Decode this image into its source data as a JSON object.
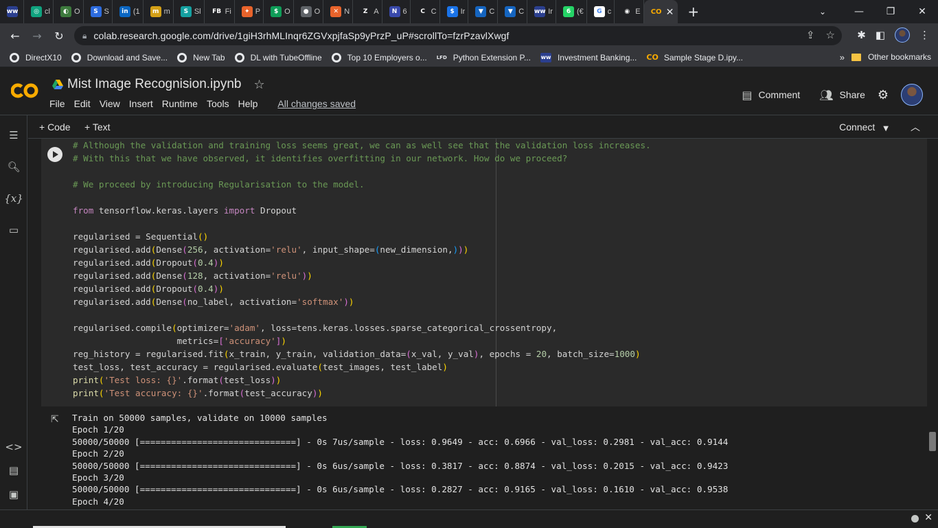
{
  "browser": {
    "tabs": [
      {
        "icon": "ww-icon",
        "label": "",
        "color": "#2b3f8f",
        "glyph": "ww"
      },
      {
        "icon": "openai-icon",
        "label": "cl",
        "color": "#10a37f",
        "glyph": "◎"
      },
      {
        "icon": "o-icon",
        "label": "O",
        "color": "#3d7a3d",
        "glyph": "◐"
      },
      {
        "icon": "s-icon",
        "label": "S",
        "color": "#2d6cdf",
        "glyph": "S"
      },
      {
        "icon": "linkedin-icon",
        "label": "(1",
        "color": "#0a66c2",
        "glyph": "in"
      },
      {
        "icon": "m-icon",
        "label": "m",
        "color": "#d4a017",
        "glyph": "m"
      },
      {
        "icon": "sl-icon",
        "label": "Sl",
        "color": "#15a1a1",
        "glyph": "S"
      },
      {
        "icon": "fb-icon",
        "label": "Fi",
        "color": "#202124",
        "glyph": "FB"
      },
      {
        "icon": "p-icon",
        "label": "P",
        "color": "#e8632b",
        "glyph": "✦"
      },
      {
        "icon": "dollar-icon",
        "label": "O",
        "color": "#0f9d58",
        "glyph": "$"
      },
      {
        "icon": "circle-icon",
        "label": "O",
        "color": "#5f6368",
        "glyph": "●"
      },
      {
        "icon": "n-icon",
        "label": "N",
        "color": "#e8632b",
        "glyph": "✕"
      },
      {
        "icon": "a-icon",
        "label": "A",
        "color": "#202124",
        "glyph": "Z"
      },
      {
        "icon": "n6-icon",
        "label": "6",
        "color": "#3949ab",
        "glyph": "N"
      },
      {
        "icon": "c-icon",
        "label": "C",
        "color": "#202124",
        "glyph": "C"
      },
      {
        "icon": "ir-icon",
        "label": "Ir",
        "color": "#1a73e8",
        "glyph": "$"
      },
      {
        "icon": "shield-icon",
        "label": "C",
        "color": "#1565c0",
        "glyph": "▼"
      },
      {
        "icon": "shield-icon-2",
        "label": "C",
        "color": "#1565c0",
        "glyph": "▼"
      },
      {
        "icon": "ww-icon-2",
        "label": "Ir",
        "color": "#2b3f8f",
        "glyph": "ww"
      },
      {
        "icon": "whatsapp-icon",
        "label": "(€",
        "color": "#25d366",
        "glyph": "6"
      },
      {
        "icon": "google-icon",
        "label": "c",
        "color": "#ffffff",
        "glyph": "G"
      },
      {
        "icon": "github-icon",
        "label": "E",
        "color": "#202124",
        "glyph": "◉"
      }
    ],
    "active_tab_icon": "CO",
    "active_tab_close": "✕",
    "new_tab": "+",
    "window_controls": {
      "dropdown": "⌄",
      "minimize": "—",
      "restore": "❐",
      "close": "✕"
    },
    "url": "colab.research.google.com/drive/1giH3rhMLInqr6ZGVxpjfaSp9yPrzP_uP#scrollTo=fzrPzavlXwgf",
    "bookmarks": [
      {
        "icon": "globe",
        "label": "DirectX10"
      },
      {
        "icon": "globe",
        "label": "Download and Save..."
      },
      {
        "icon": "globe",
        "label": "New Tab"
      },
      {
        "icon": "globe",
        "label": "DL with TubeOffline"
      },
      {
        "icon": "globe",
        "label": "Top 10 Employers o..."
      },
      {
        "icon": "lfd",
        "label": "Python Extension P..."
      },
      {
        "icon": "ww",
        "label": "Investment Banking..."
      },
      {
        "icon": "co",
        "label": "Sample Stage D.ipy..."
      }
    ],
    "bookmarks_more": "»",
    "other_bookmarks": "Other bookmarks"
  },
  "colab": {
    "title": "Mist Image Recognision.ipynb",
    "menu": [
      "File",
      "Edit",
      "View",
      "Insert",
      "Runtime",
      "Tools",
      "Help"
    ],
    "save_status": "All changes saved",
    "comment_label": "Comment",
    "share_label": "Share",
    "toolbar": {
      "code": "+ Code",
      "text": "+ Text",
      "connect": "Connect"
    }
  },
  "output_lines": [
    "Train on 50000 samples, validate on 10000 samples",
    "Epoch 1/20",
    "50000/50000 [==============================] - 0s 7us/sample - loss: 0.9649 - acc: 0.6966 - val_loss: 0.2981 - val_acc: 0.9144",
    "Epoch 2/20",
    "50000/50000 [==============================] - 0s 6us/sample - loss: 0.3817 - acc: 0.8874 - val_loss: 0.2015 - val_acc: 0.9423",
    "Epoch 3/20",
    "50000/50000 [==============================] - 0s 6us/sample - loss: 0.2827 - acc: 0.9165 - val_loss: 0.1610 - val_acc: 0.9538",
    "Epoch 4/20"
  ]
}
